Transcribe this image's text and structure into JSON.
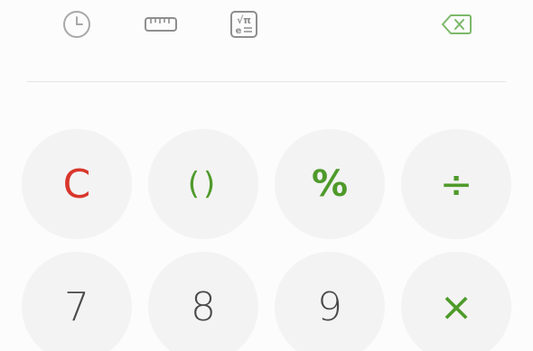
{
  "toolbar": {
    "history_icon": "clock-icon",
    "unit_icon": "ruler-icon",
    "scientific_icon": "scientific-mode-icon",
    "backspace_icon": "backspace-icon",
    "scientific_glyphs": {
      "sqrt": "√π",
      "e": "e"
    }
  },
  "keypad": {
    "row1": {
      "clear": "C",
      "parens": "()",
      "percent": "%",
      "divide": "÷"
    },
    "row2": {
      "seven": "7",
      "eight": "8",
      "nine": "9",
      "multiply": "×"
    }
  },
  "colors": {
    "accent_green": "#4e9a2a",
    "clear_red": "#d9362c",
    "digit_gray": "#4a4a4a",
    "icon_gray": "#a8a8a8",
    "backspace_green": "#7cb86a",
    "key_background": "#f3f3f3",
    "screen_background": "#fcfcfc"
  }
}
